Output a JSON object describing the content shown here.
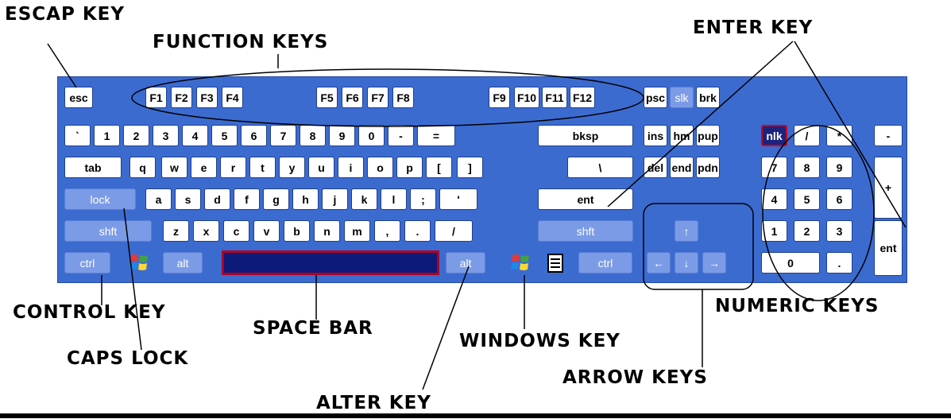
{
  "labels": {
    "escape_key": "ESCAP KEY",
    "function_keys": "FUNCTION KEYS",
    "enter_key": "ENTER KEY",
    "control_key": "CONTROL KEY",
    "space_bar": "SPACE BAR",
    "windows_key": "WINDOWS KEY",
    "numeric_keys": "NUMERIC KEYS",
    "caps_lock": "CAPS LOCK",
    "arrow_keys": "ARROW KEYS",
    "alter_key": "ALTER KEY"
  },
  "keys": {
    "esc": "esc",
    "f1": "F1",
    "f2": "F2",
    "f3": "F3",
    "f4": "F4",
    "f5": "F5",
    "f6": "F6",
    "f7": "F7",
    "f8": "F8",
    "f9": "F9",
    "f10": "F10",
    "f11": "F11",
    "f12": "F12",
    "psc": "psc",
    "slk": "slk",
    "brk": "brk",
    "backtick": "`",
    "n1": "1",
    "n2": "2",
    "n3": "3",
    "n4": "4",
    "n5": "5",
    "n6": "6",
    "n7": "7",
    "n8": "8",
    "n9": "9",
    "n0": "0",
    "minus": "-",
    "equals": "=",
    "bksp": "bksp",
    "ins": "ins",
    "hm": "hm",
    "pup": "pup",
    "nlk": "nlk",
    "np_slash": "/",
    "np_star": "*",
    "np_minus": "-",
    "tab": "tab",
    "q": "q",
    "w": "w",
    "e": "e",
    "r": "r",
    "t": "t",
    "y": "y",
    "u": "u",
    "i": "i",
    "o": "o",
    "p": "p",
    "lbracket": "[",
    "rbracket": "]",
    "backslash": "\\",
    "del": "del",
    "end": "end",
    "pdn": "pdn",
    "np7": "7",
    "np8": "8",
    "np9": "9",
    "np_plus": "+",
    "lock": "lock",
    "a": "a",
    "s": "s",
    "d": "d",
    "f": "f",
    "g": "g",
    "h": "h",
    "j": "j",
    "k": "k",
    "l": "l",
    "semicolon": ";",
    "quote": "'",
    "ent": "ent",
    "np4": "4",
    "np5": "5",
    "np6": "6",
    "shft_left": "shft",
    "z": "z",
    "x": "x",
    "c": "c",
    "v": "v",
    "b": "b",
    "n": "n",
    "m": "m",
    "comma": ",",
    "period": ".",
    "slash": "/",
    "shft_right": "shft",
    "up": "↑",
    "np1": "1",
    "np2": "2",
    "np3": "3",
    "np_ent": "ent",
    "ctrl_left": "ctrl",
    "alt_left": "alt",
    "alt_right": "alt",
    "ctrl_right": "ctrl",
    "left": "←",
    "down": "↓",
    "right": "→",
    "np0": "0",
    "np_dot": "."
  },
  "colors": {
    "keyboard_bg": "#3c6bd0",
    "modifier_key": "#7b9be6",
    "space_bar": "#0d1a7a",
    "space_bar_border": "#b00020",
    "nlk_key": "#1a237e"
  },
  "icons": {
    "windows_logo": "windows-logo-icon",
    "context_menu": "context-menu-icon"
  }
}
